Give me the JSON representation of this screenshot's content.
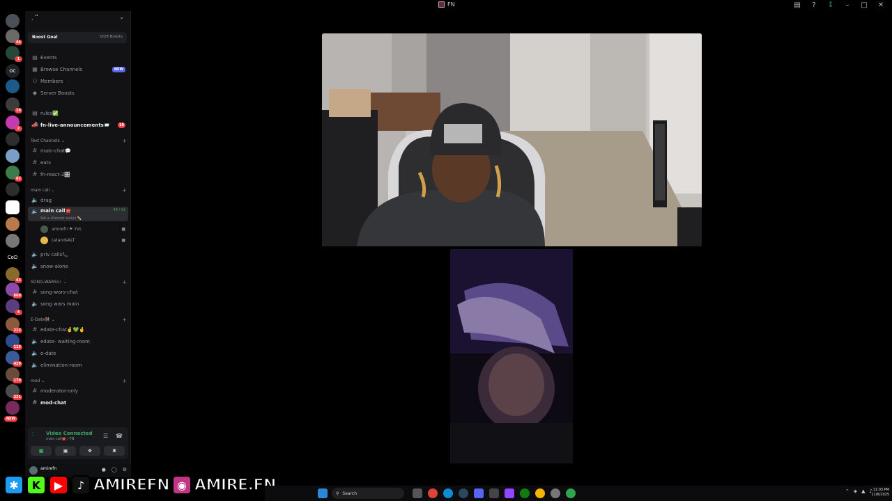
{
  "window": {
    "title": "FN"
  },
  "sidebar": {
    "server_name": "ˏ ˮ",
    "boost_goal": {
      "label": "Boost Goal",
      "progress": "0/28 Boosts"
    },
    "menu": [
      {
        "label": "Events",
        "icon": "calendar-icon"
      },
      {
        "label": "Browse Channels",
        "icon": "browse-icon",
        "tag": "NEW"
      },
      {
        "label": "Members",
        "icon": "members-icon"
      },
      {
        "label": "Server Boosts",
        "icon": "boost-icon"
      }
    ],
    "pinned": [
      {
        "label": "rules✅",
        "icon": "rules-icon"
      },
      {
        "label": "fn-live-announcements📨",
        "icon": "announcement-icon",
        "badge": "18"
      }
    ],
    "categories": {
      "text": "Text Channels",
      "main_call": "main call",
      "song_wars": "SONG-WARS🎶",
      "edate": "E-Date👫",
      "mod": "mod"
    },
    "text_channels": [
      "main-chat💬",
      "eats",
      "fn-react-2🎛️"
    ],
    "voice_main": {
      "drag": "drag",
      "main_call": "main call☎️",
      "main_call_count": "48 / 42",
      "status": "Set a channel status ✏️",
      "users": [
        "amirefn ⚑ YVL",
        "LelandsALT"
      ],
      "priv_calls": "priv calls📞",
      "snow_alone": "snow-alone"
    },
    "song_wars": [
      "song-wars-chat",
      "song wars main"
    ],
    "edate": [
      "edate-chat🤞💚🤞",
      "edate- waiting-room",
      "e-date",
      "elimination-room"
    ],
    "mod": [
      "moderator-only",
      "mod-chat"
    ],
    "voice_panel": {
      "status": "Video Connected",
      "channel": "main call☎️ / FN"
    },
    "user": {
      "name": "amirefn"
    }
  },
  "rail": {
    "badges": [
      "44",
      "1",
      "18",
      "2",
      "62",
      "2",
      "1",
      "CoD",
      "43",
      "660",
      "4",
      "213",
      "115",
      "429",
      "170",
      "221",
      "NEW"
    ]
  },
  "banner": {
    "handle1": "AMIREFN",
    "handle2": "AMIRE.FN"
  },
  "taskbar": {
    "search_placeholder": "Search",
    "time": "11:03 PM",
    "date": "11/6/2025"
  }
}
